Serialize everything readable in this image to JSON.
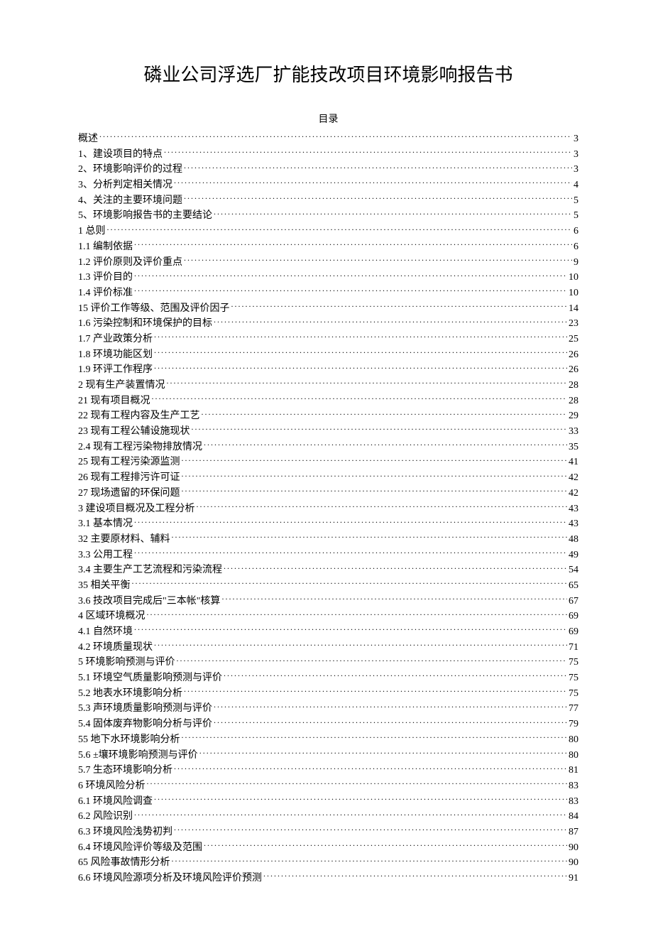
{
  "title": "磷业公司浮选厂扩能技改项目环境影响报告书",
  "toc_heading": "目录",
  "toc": [
    {
      "label": "概述",
      "page": "3"
    },
    {
      "label": "1、建设项目的特点",
      "page": "3"
    },
    {
      "label": "2、环境影响评价的过程",
      "page": "3"
    },
    {
      "label": "3、分析判定相关情况",
      "page": "4"
    },
    {
      "label": "4、关注的主要环境问题",
      "page": "5"
    },
    {
      "label": "5、环境影响报告书的主要结论",
      "page": "5"
    },
    {
      "label": "1 总则",
      "page": "6"
    },
    {
      "label": "1.1 编制依据",
      "page": "6"
    },
    {
      "label": "1.2  评价原则及评价重点",
      "page": "9"
    },
    {
      "label": "1.3  评价目的",
      "page": "10"
    },
    {
      "label": "1.4  评价标准",
      "page": "10"
    },
    {
      "label": "15 评价工作等级、范围及评价因子",
      "page": "14"
    },
    {
      "label": "1.6  污染控制和环境保护的目标",
      "page": "23"
    },
    {
      "label": "1.7  产业政策分析",
      "page": "25"
    },
    {
      "label": "1.8  环境功能区划",
      "page": "26"
    },
    {
      "label": "1.9  环评工作程序",
      "page": "26"
    },
    {
      "label": "2 现有生产装置情况",
      "page": "28"
    },
    {
      "label": "21 现有项目概况",
      "page": "28"
    },
    {
      "label": "22 现有工程内容及生产工艺",
      "page": "29"
    },
    {
      "label": "23 现有工程公辅设施现状",
      "page": "33"
    },
    {
      "label": "2.4 现有工程污染物排放情况",
      "page": "35"
    },
    {
      "label": "25 现有工程污染源监测",
      "page": "41"
    },
    {
      "label": "26 现有工程排污许可证",
      "page": "42"
    },
    {
      "label": "27 现场遗留的环保问题",
      "page": "42"
    },
    {
      "label": "3 建设项目概况及工程分析",
      "page": "43"
    },
    {
      "label": "3.1  基本情况",
      "page": "43"
    },
    {
      "label": "32 主要原材料、辅料",
      "page": "48"
    },
    {
      "label": "3.3  公用工程",
      "page": "49"
    },
    {
      "label": "3.4  主要生产工艺流程和污染流程",
      "page": "54"
    },
    {
      "label": "35 相关平衡",
      "page": "65"
    },
    {
      "label": "3.6  技改项目完成后\"三本帐\"核算",
      "page": "67"
    },
    {
      "label": "4 区域环境概况",
      "page": "69"
    },
    {
      "label": "4.1  自然环境",
      "page": "69"
    },
    {
      "label": "4.2  环境质量现状",
      "page": "71"
    },
    {
      "label": "5 环境影响预测与评价",
      "page": "75"
    },
    {
      "label": "5.1  环境空气质量影响预测与评价",
      "page": "75"
    },
    {
      "label": "5.2  地表水环境影响分析",
      "page": "75"
    },
    {
      "label": "5.3  声环境质量影响预测与评价",
      "page": "77"
    },
    {
      "label": "5.4  固体废弃物影响分析与评价",
      "page": "79"
    },
    {
      "label": "55 地下水环境影响分析",
      "page": "80"
    },
    {
      "label": "5.6  ±壤环境影响预测与评价",
      "page": "80"
    },
    {
      "label": "5.7  生态环境影响分析",
      "page": "81"
    },
    {
      "label": "6 环境风险分析",
      "page": "83"
    },
    {
      "label": "6.1  环境风险调查",
      "page": "83"
    },
    {
      "label": "6.2  风险识别",
      "page": "84"
    },
    {
      "label": "6.3  环境风险浅势初判",
      "page": "87"
    },
    {
      "label": "6.4  环境风险评价等级及范围",
      "page": "90"
    },
    {
      "label": "65 风险事故情形分析",
      "page": "90"
    },
    {
      "label": "6.6  环境风险源项分析及环境风险评价预测",
      "page": "91"
    }
  ]
}
